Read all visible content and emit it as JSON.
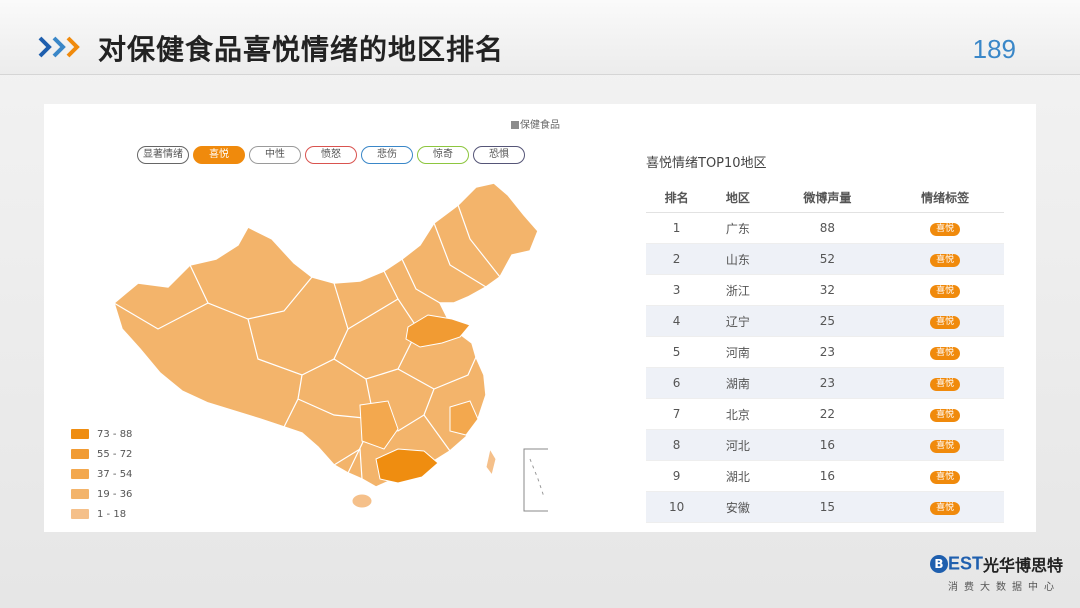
{
  "header": {
    "title": "对保健食品喜悦情绪的地区排名",
    "page_number": "189"
  },
  "series_legend": "保健食品",
  "emotion_filters": [
    {
      "label": "显著情绪",
      "active": false,
      "color": "#666666"
    },
    {
      "label": "喜悦",
      "active": true,
      "color": "#f08a0c"
    },
    {
      "label": "中性",
      "active": false,
      "color": "#9a9a9a"
    },
    {
      "label": "愤怒",
      "active": false,
      "color": "#d9534f"
    },
    {
      "label": "悲伤",
      "active": false,
      "color": "#3a87c8"
    },
    {
      "label": "惊奇",
      "active": false,
      "color": "#8dc63f"
    },
    {
      "label": "恐惧",
      "active": false,
      "color": "#555577"
    }
  ],
  "range_legend": [
    {
      "label": "73 - 88",
      "color": "#ef8d10"
    },
    {
      "label": "55 - 72",
      "color": "#f19b33"
    },
    {
      "label": "37 - 54",
      "color": "#f3a84e"
    },
    {
      "label": "19 - 36",
      "color": "#f3b46b"
    },
    {
      "label": "1 - 18",
      "color": "#f5c08a"
    }
  ],
  "table": {
    "title": "喜悦情绪TOP10地区",
    "headers": [
      "排名",
      "地区",
      "微博声量",
      "情绪标签"
    ],
    "rows": [
      {
        "rank": "1",
        "region": "广东",
        "volume": "88",
        "tag": "喜悦"
      },
      {
        "rank": "2",
        "region": "山东",
        "volume": "52",
        "tag": "喜悦"
      },
      {
        "rank": "3",
        "region": "浙江",
        "volume": "32",
        "tag": "喜悦"
      },
      {
        "rank": "4",
        "region": "辽宁",
        "volume": "25",
        "tag": "喜悦"
      },
      {
        "rank": "5",
        "region": "河南",
        "volume": "23",
        "tag": "喜悦"
      },
      {
        "rank": "6",
        "region": "湖南",
        "volume": "23",
        "tag": "喜悦"
      },
      {
        "rank": "7",
        "region": "北京",
        "volume": "22",
        "tag": "喜悦"
      },
      {
        "rank": "8",
        "region": "河北",
        "volume": "16",
        "tag": "喜悦"
      },
      {
        "rank": "9",
        "region": "湖北",
        "volume": "16",
        "tag": "喜悦"
      },
      {
        "rank": "10",
        "region": "安徽",
        "volume": "15",
        "tag": "喜悦"
      }
    ]
  },
  "logo": {
    "badge": "B",
    "brand": "EST",
    "name": "光华博思特",
    "subtitle": "消费大数据中心"
  }
}
